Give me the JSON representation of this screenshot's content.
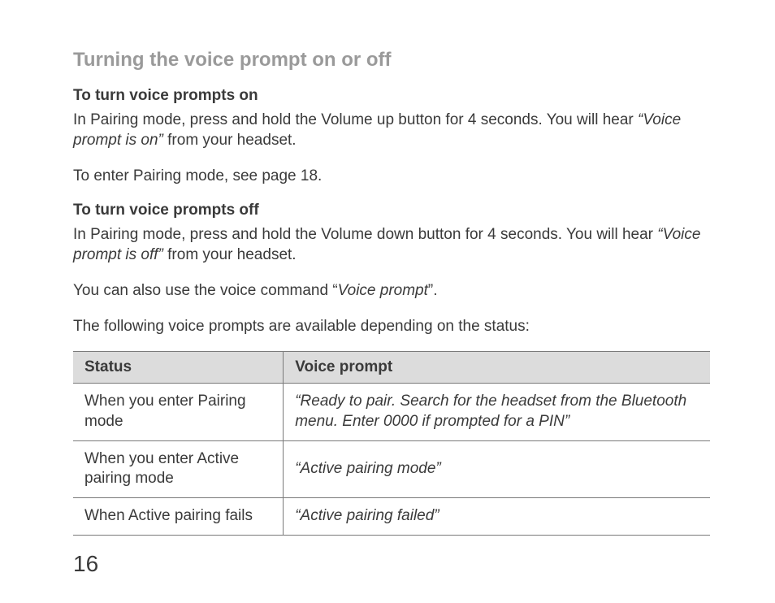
{
  "title": "Turning the voice prompt on or off",
  "section_on": {
    "heading": "To turn voice prompts on",
    "p1_a": "In Pairing mode, press and hold the Volume up button for 4 seconds. You will hear ",
    "p1_quote": "“Voice prompt is on”",
    "p1_b": " from your headset.",
    "p2": "To enter Pairing mode, see page 18."
  },
  "section_off": {
    "heading": "To turn voice prompts off",
    "p1_a": "In Pairing mode, press and hold the Volume down button for 4 seconds. You will hear ",
    "p1_quote": "“Voice prompt is off”",
    "p1_b": " from your headset.",
    "p2_a": "You can also use the voice command “",
    "p2_quote": "Voice prompt",
    "p2_b": "”.",
    "p3": "The following voice prompts are available depending on the status:"
  },
  "table": {
    "headers": {
      "status": "Status",
      "prompt": "Voice prompt"
    },
    "rows": [
      {
        "status": "When you enter Pairing mode",
        "prompt": "“Ready to pair. Search for the headset from the Bluetooth menu. Enter 0000 if prompted for a PIN”"
      },
      {
        "status": "When you enter Active pairing mode",
        "prompt": "“Active pairing mode”"
      },
      {
        "status": "When Active pairing fails",
        "prompt": "“Active pairing failed”"
      }
    ]
  },
  "page_number": "16"
}
